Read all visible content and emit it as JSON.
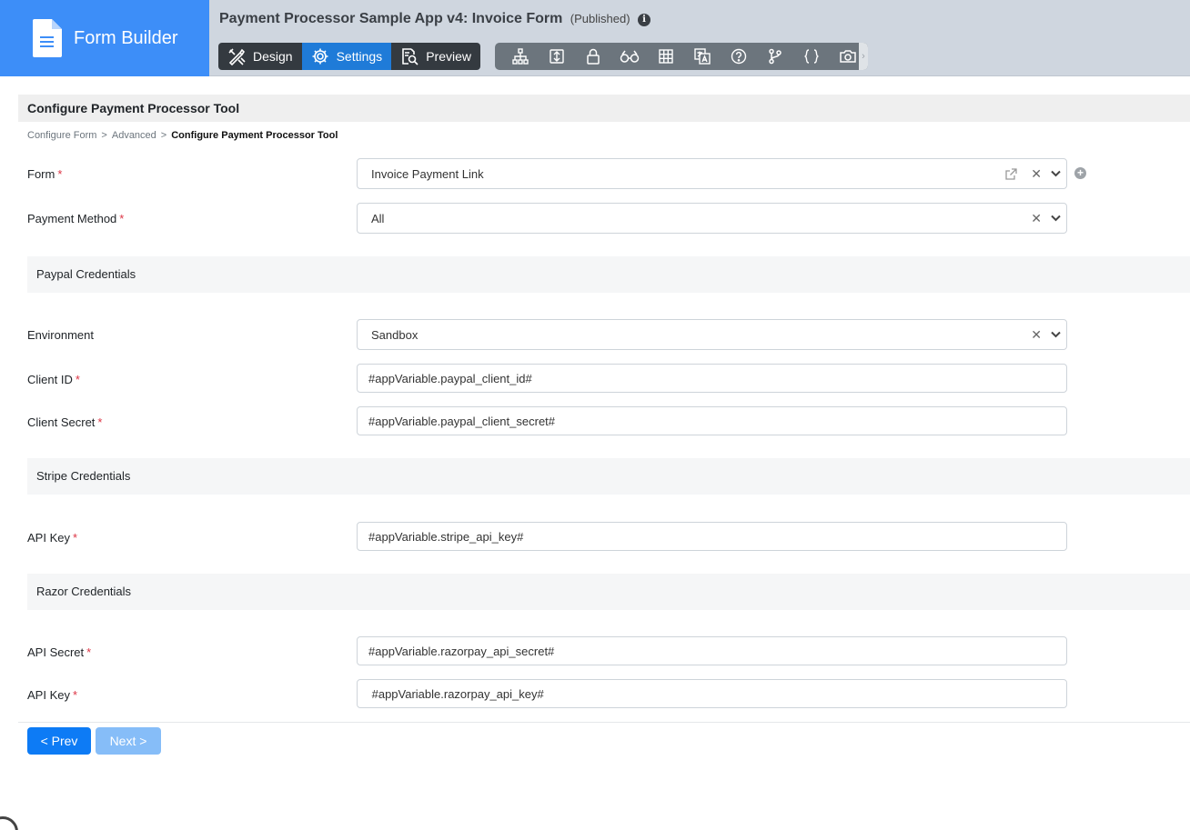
{
  "brand": {
    "title": "Form Builder"
  },
  "header": {
    "app_title": "Payment Processor Sample App v4: Invoice Form",
    "status": "(Published)",
    "modes": {
      "design": "Design",
      "settings": "Settings",
      "preview": "Preview"
    },
    "tools": [
      "sitemap-icon",
      "form-icon",
      "lock-icon",
      "binoculars-icon",
      "grid-icon",
      "translate-icon",
      "help-icon",
      "branch-icon",
      "braces-icon",
      "camera-icon"
    ],
    "tools_more": "›"
  },
  "page": {
    "title": "Configure Payment Processor Tool",
    "breadcrumb": [
      "Configure Form",
      "Advanced",
      "Configure Payment Processor Tool"
    ],
    "breadcrumb_sep": ">"
  },
  "fields": {
    "form": {
      "label": "Form",
      "value": "Invoice Payment Link"
    },
    "payment_method": {
      "label": "Payment Method",
      "value": "All"
    },
    "paypal_header": "Paypal Credentials",
    "environment": {
      "label": "Environment",
      "value": "Sandbox"
    },
    "client_id": {
      "label": "Client ID",
      "value": "#appVariable.paypal_client_id#"
    },
    "client_secret": {
      "label": "Client Secret",
      "value": "#appVariable.paypal_client_secret#"
    },
    "stripe_header": "Stripe Credentials",
    "stripe_api_key": {
      "label": "API Key",
      "value": "#appVariable.stripe_api_key#"
    },
    "razor_header": "Razor Credentials",
    "razor_api_secret": {
      "label": "API Secret",
      "value": "#appVariable.razorpay_api_secret#"
    },
    "razor_api_key": {
      "label": "API Key",
      "value": " #appVariable.razorpay_api_key#"
    }
  },
  "required_mark": "*",
  "buttons": {
    "prev": "< Prev",
    "next": "Next >"
  },
  "colors": {
    "brand": "#3d8ef8",
    "active_mode": "#1f7bd8",
    "primary": "#0d7bf5",
    "required": "#dc3545"
  }
}
